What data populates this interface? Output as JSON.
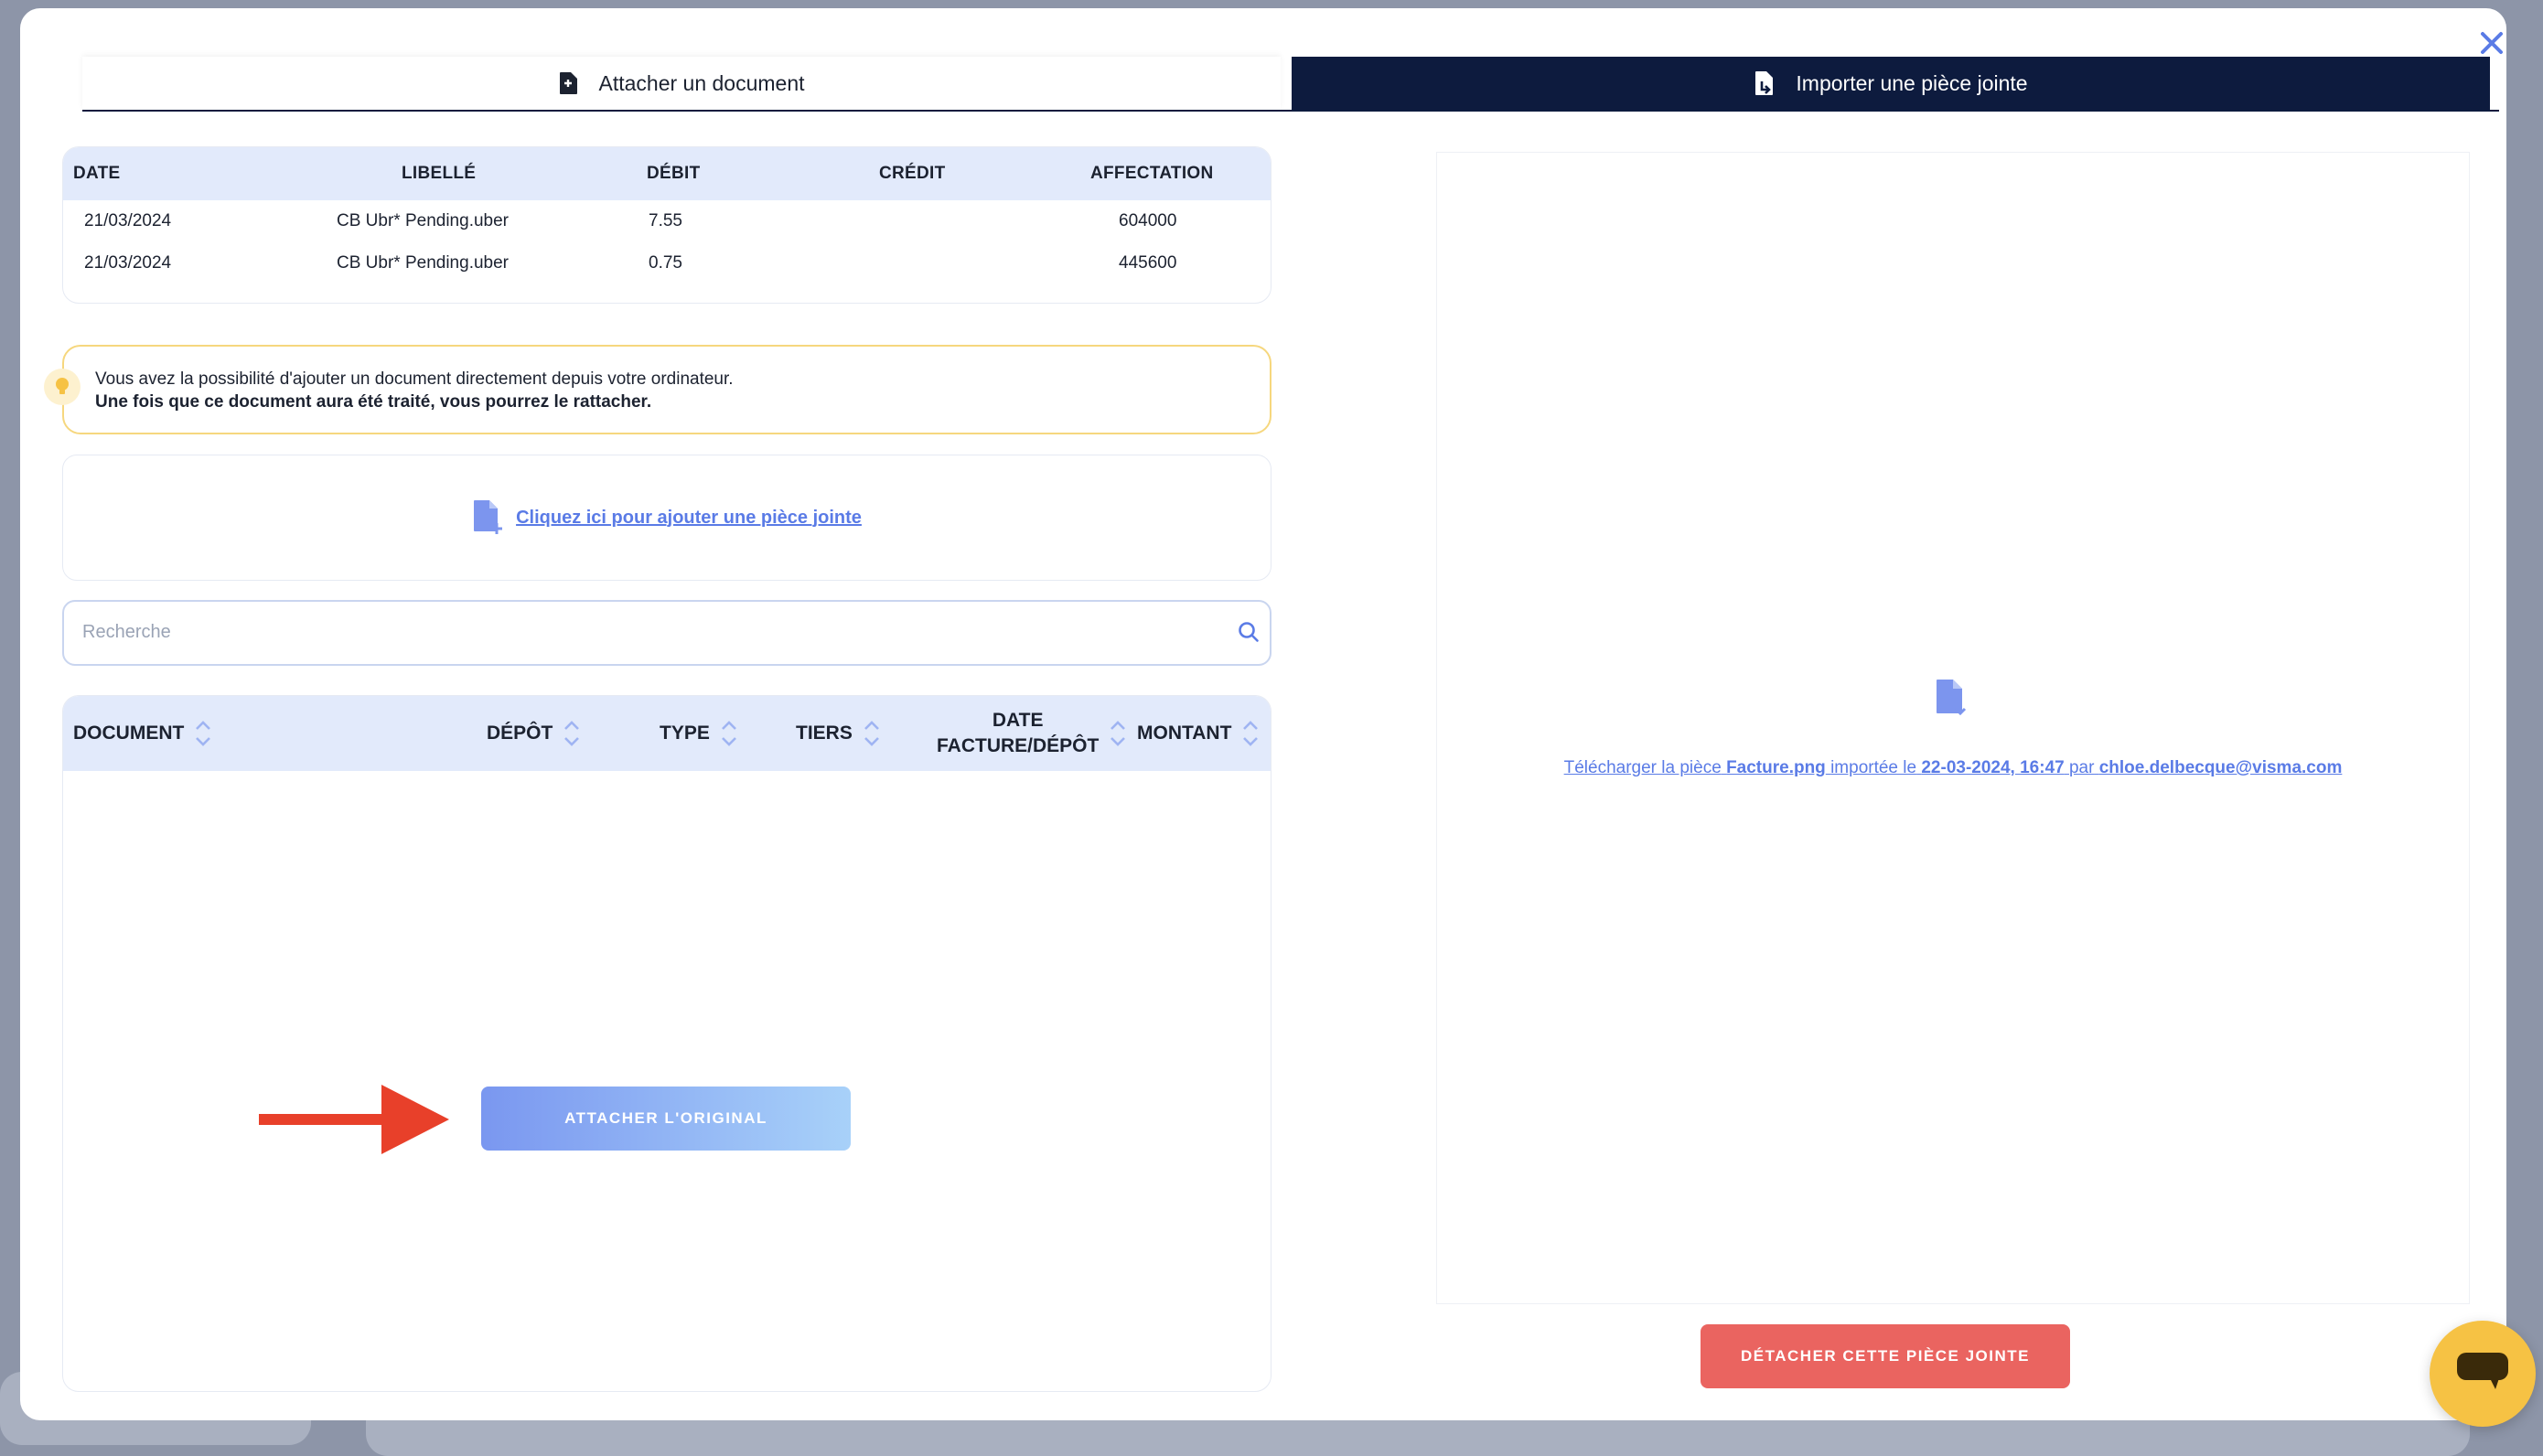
{
  "tabs": {
    "attach_label": "Attacher un document",
    "import_label": "Importer une pièce jointe"
  },
  "transactions": {
    "headers": [
      "DATE",
      "LIBELLÉ",
      "DÉBIT",
      "CRÉDIT",
      "AFFECTATION"
    ],
    "rows": [
      {
        "date": "21/03/2024",
        "libelle": "CB Ubr* Pending.uber",
        "debit": "7.55",
        "credit": "",
        "affectation": "604000"
      },
      {
        "date": "21/03/2024",
        "libelle": "CB Ubr* Pending.uber",
        "debit": "0.75",
        "credit": "",
        "affectation": "445600"
      }
    ]
  },
  "info": {
    "line1": "Vous avez la possibilité d'ajouter un document directement depuis votre ordinateur.",
    "line2": "Une fois que ce document aura été traité, vous pourrez le rattacher."
  },
  "upload": {
    "link_label": "Cliquez ici pour ajouter une pièce jointe"
  },
  "search": {
    "placeholder": "Recherche",
    "value": ""
  },
  "documents": {
    "headers": {
      "document": "DOCUMENT",
      "depot": "DÉPÔT",
      "type": "TYPE",
      "tiers": "TIERS",
      "date_line1": "DATE",
      "date_line2": "FACTURE/DÉPÔT",
      "montant": "MONTANT"
    },
    "attach_button": "ATTACHER L'ORIGINAL"
  },
  "preview": {
    "prefix": "Télécharger la pièce",
    "filename": "Facture.png",
    "mid": "importée le",
    "datetime": "22-03-2024, 16:47",
    "by": "par",
    "user": "chloe.delbecque@visma.com"
  },
  "detach_button": "DÉTACHER CETTE PIÈCE JOINTE",
  "colors": {
    "navy": "#0d1b3e",
    "accent": "#5a7be6",
    "danger": "#ea6460",
    "header_bg": "#e2eafb",
    "warning_border": "#f6d77e",
    "chat": "#f6c244",
    "annotation_arrow": "#e8402a"
  },
  "icons": [
    "close-icon",
    "file-attach-icon",
    "file-import-icon",
    "lightbulb-icon",
    "file-add-icon",
    "search-icon",
    "sort-icon",
    "file-download-icon",
    "chat-icon",
    "annotation-arrow"
  ]
}
